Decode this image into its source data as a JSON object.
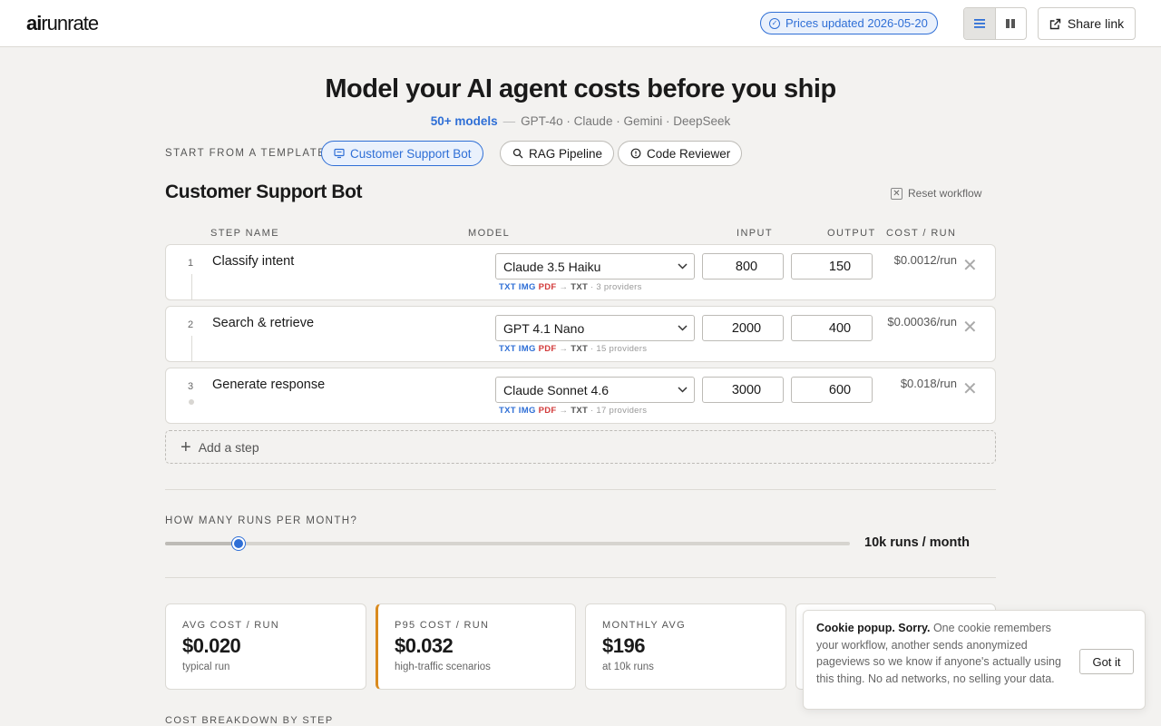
{
  "header": {
    "logo_bold": "ai",
    "logo_light": "runrate",
    "prices_badge": "Prices updated 2026-05-20",
    "share_label": "Share link"
  },
  "hero": {
    "title": "Model your AI agent costs before you ship",
    "models_count": "50+ models",
    "models_list": "GPT-4o · Claude · Gemini · DeepSeek"
  },
  "templates": {
    "label": "START FROM A TEMPLATE:",
    "items": [
      {
        "label": "Customer Support Bot",
        "icon": "chat-icon",
        "active": true
      },
      {
        "label": "RAG Pipeline",
        "icon": "search-icon",
        "active": false
      },
      {
        "label": "Code Reviewer",
        "icon": "code-icon",
        "active": false
      }
    ]
  },
  "workflow": {
    "title": "Customer Support Bot",
    "reset_label": "Reset workflow",
    "columns": [
      "STEP NAME",
      "MODEL",
      "INPUT",
      "OUTPUT",
      "COST / RUN"
    ],
    "steps": [
      {
        "num": "1",
        "name": "Classify intent",
        "model": "Claude 3.5 Haiku",
        "input": "800",
        "output": "150",
        "cost": "$0.0012/run",
        "providers": "3 providers"
      },
      {
        "num": "2",
        "name": "Search & retrieve",
        "model": "GPT 4.1 Nano",
        "input": "2000",
        "output": "400",
        "cost": "$0.00036/run",
        "providers": "15 providers"
      },
      {
        "num": "3",
        "name": "Generate response",
        "model": "Claude Sonnet 4.6",
        "input": "3000",
        "output": "600",
        "cost": "$0.018/run",
        "providers": "17 providers"
      }
    ],
    "caps": {
      "in1": "TXT",
      "in2": "IMG",
      "in3": "PDF",
      "arrow": "→",
      "out": "TXT"
    },
    "add_step_label": "Add a step"
  },
  "runs": {
    "label": "HOW MANY RUNS PER MONTH?",
    "value_label": "10k runs / month",
    "slider_fraction": 0.107
  },
  "cards": [
    {
      "label": "AVG COST / RUN",
      "value": "$0.020",
      "sub": "typical run"
    },
    {
      "label": "P95 COST / RUN",
      "value": "$0.032",
      "sub": "high-traffic scenarios"
    },
    {
      "label": "MONTHLY AVG",
      "value": "$196",
      "sub": "at 10k runs"
    }
  ],
  "breakdown_label": "COST BREAKDOWN BY STEP",
  "cookie": {
    "title": "Cookie popup. Sorry.",
    "body": " One cookie remembers your workflow, another sends anonymized pageviews so we know if anyone's actually using this thing. No ad networks, no selling your data.",
    "button": "Got it"
  },
  "colors": {
    "accent": "#2f6fd6",
    "highlight": "#d98a1e",
    "pdf": "#d23a3a"
  }
}
